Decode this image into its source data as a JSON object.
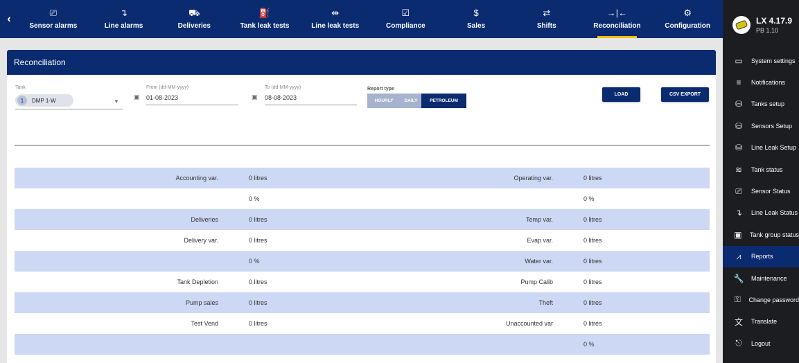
{
  "nav": {
    "back_icon": "chevron-left-icon",
    "items": [
      {
        "label": "Sensor alarms",
        "icon": "cast-icon",
        "glyph": "⎚"
      },
      {
        "label": "Line alarms",
        "icon": "pipe-icon",
        "glyph": "↴"
      },
      {
        "label": "Deliveries",
        "icon": "truck-icon",
        "glyph": "⛟"
      },
      {
        "label": "Tank leak tests",
        "icon": "tank-leak-icon",
        "glyph": "⛽"
      },
      {
        "label": "Line leak tests",
        "icon": "line-leak-icon",
        "glyph": "⇹"
      },
      {
        "label": "Compliance",
        "icon": "checkbox-icon",
        "glyph": "☑"
      },
      {
        "label": "Sales",
        "icon": "dollar-icon",
        "glyph": "$"
      },
      {
        "label": "Shifts",
        "icon": "swap-icon",
        "glyph": "⇄"
      },
      {
        "label": "Reconciliation",
        "icon": "reconcile-icon",
        "glyph": "→|←"
      },
      {
        "label": "Configuration",
        "icon": "gear-icon",
        "glyph": "⚙"
      }
    ],
    "active_index": 8
  },
  "sidebar": {
    "version": "LX 4.17.9",
    "subversion": "PB 1.10",
    "items": [
      {
        "label": "System settings",
        "icon": "monitor-icon",
        "glyph": "▭"
      },
      {
        "label": "Notifications",
        "icon": "notifications-icon",
        "glyph": "≡"
      },
      {
        "label": "Tanks setup",
        "icon": "database-icon",
        "glyph": "⛁"
      },
      {
        "label": "Sensors Setup",
        "icon": "database-icon",
        "glyph": "⛁"
      },
      {
        "label": "Line Leak Setup",
        "icon": "database-icon",
        "glyph": "⛁"
      },
      {
        "label": "Tank status",
        "icon": "waves-icon",
        "glyph": "≋"
      },
      {
        "label": "Sensor Status",
        "icon": "cast-icon",
        "glyph": "⎚"
      },
      {
        "label": "Line Leak Status",
        "icon": "pipe-icon",
        "glyph": "↴"
      },
      {
        "label": "Tank group status",
        "icon": "tank-group-icon",
        "glyph": "▣"
      },
      {
        "label": "Reports",
        "icon": "chart-icon",
        "glyph": "⩘"
      },
      {
        "label": "Maintenance",
        "icon": "wrench-icon",
        "glyph": "🔧"
      },
      {
        "label": "Change password",
        "icon": "key-icon",
        "glyph": "⚿"
      },
      {
        "label": "Translate",
        "icon": "translate-icon",
        "glyph": "文"
      },
      {
        "label": "Logout",
        "icon": "logout-icon",
        "glyph": "⎋"
      }
    ],
    "active_index": 9
  },
  "main": {
    "title": "Reconciliation",
    "tank": {
      "label": "Tank",
      "chip_number": "1",
      "chip_name": "DMP 1-W"
    },
    "from": {
      "label": "From (dd-MM-yyyy)",
      "value": "01-08-2023"
    },
    "to": {
      "label": "To (dd-MM-yyyy)",
      "value": "08-08-2023"
    },
    "report_type": {
      "label": "Report type",
      "options": [
        "HOURLY",
        "DAILY",
        "PETROLEUM"
      ],
      "selected": "PETROLEUM"
    },
    "load_label": "LOAD",
    "csv_label": "CSV EXPORT"
  },
  "rows": [
    {
      "l1": "Accounting var.",
      "v1": "0  litres",
      "l2": "Operating var.",
      "v2": "0  litres"
    },
    {
      "l1": "",
      "v1": "0  %",
      "l2": "",
      "v2": "0  %"
    },
    {
      "l1": "Deliveries",
      "v1": "0  litres",
      "l2": "Temp var.",
      "v2": "0  litres"
    },
    {
      "l1": "Delivery var.",
      "v1": "0  litres",
      "l2": "Evap var.",
      "v2": "0  litres"
    },
    {
      "l1": "",
      "v1": "0  %",
      "l2": "Water var.",
      "v2": "0  litres"
    },
    {
      "l1": "Tank Depletion",
      "v1": "0  litres",
      "l2": "Pump Calib",
      "v2": "0  litres"
    },
    {
      "l1": "Pump sales",
      "v1": "0  litres",
      "l2": "Theft",
      "v2": "0  litres"
    },
    {
      "l1": "Test Vend",
      "v1": "0  litres",
      "l2": "Unaccounted var",
      "v2": "0  litres"
    },
    {
      "l1": "",
      "v1": "",
      "l2": "",
      "v2": "0  %"
    }
  ],
  "colors": {
    "navy": "#0a2b70",
    "accent_yellow": "#f4c10f",
    "row_shade": "#cdd8f5",
    "sidebar_bg": "#1c1d21"
  }
}
